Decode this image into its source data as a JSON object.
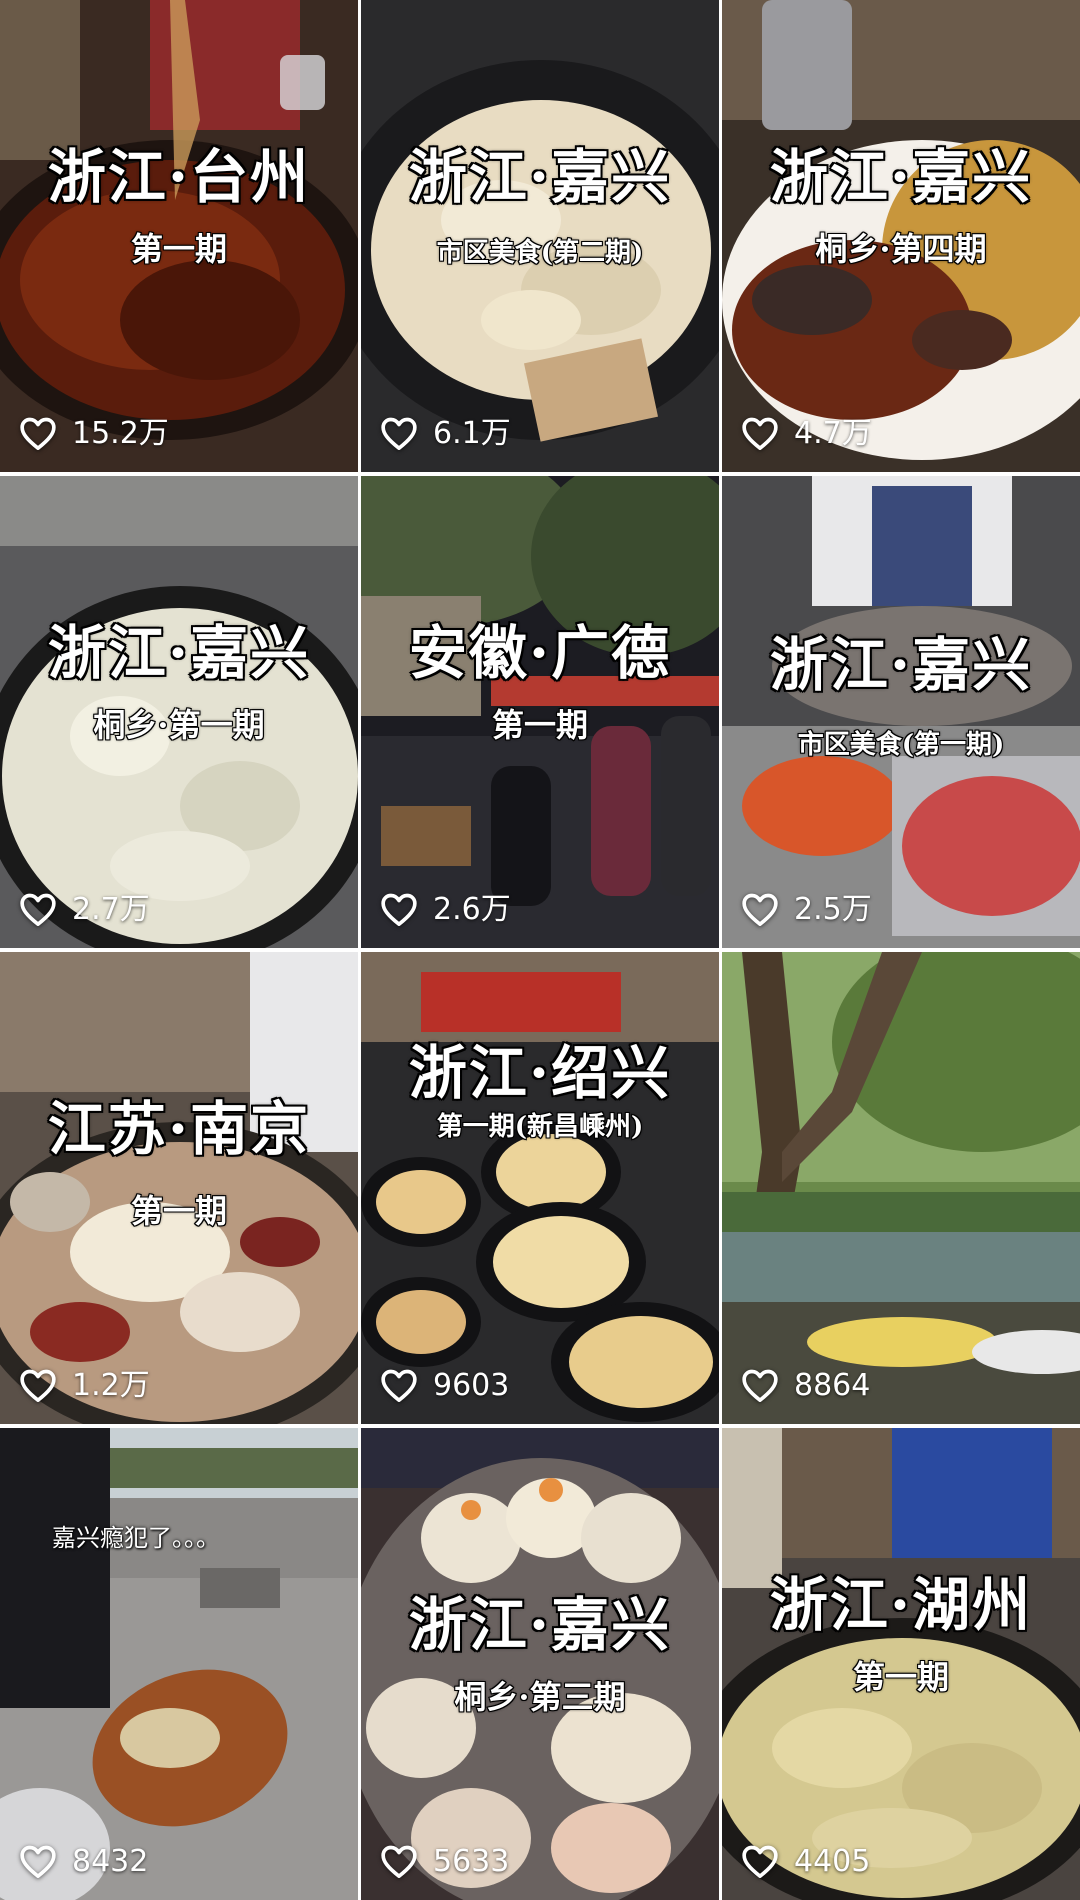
{
  "videos": [
    {
      "title": "浙江·台州",
      "subtitle": "第一期",
      "likes": "15.2万"
    },
    {
      "title": "浙江·嘉兴",
      "subtitle": "市区美食(第二期)",
      "likes": "6.1万"
    },
    {
      "title": "浙江·嘉兴",
      "subtitle": "桐乡·第四期",
      "likes": "4.7万"
    },
    {
      "title": "浙江·嘉兴",
      "subtitle": "桐乡·第一期",
      "likes": "2.7万"
    },
    {
      "title": "安徽·广德",
      "subtitle": "第一期",
      "likes": "2.6万"
    },
    {
      "title": "浙江·嘉兴",
      "subtitle": "市区美食(第一期)",
      "likes": "2.5万"
    },
    {
      "title": "江苏·南京",
      "subtitle": "第一期",
      "likes": "1.2万"
    },
    {
      "title": "浙江·绍兴",
      "subtitle": "第一期(新昌嵊州)",
      "likes": "9603"
    },
    {
      "title": "",
      "subtitle": "",
      "likes": "8864"
    },
    {
      "title": "",
      "subtitle": "",
      "caption": "嘉兴瘾犯了。。。",
      "likes": "8432"
    },
    {
      "title": "浙江·嘉兴",
      "subtitle": "桐乡·第三期",
      "likes": "5633"
    },
    {
      "title": "浙江·湖州",
      "subtitle": "第一期",
      "likes": "4405"
    }
  ],
  "icons": {
    "like": "heart-outline-icon"
  },
  "colors": {
    "overlay_text": "#ffffff",
    "text_outline": "#000000"
  }
}
